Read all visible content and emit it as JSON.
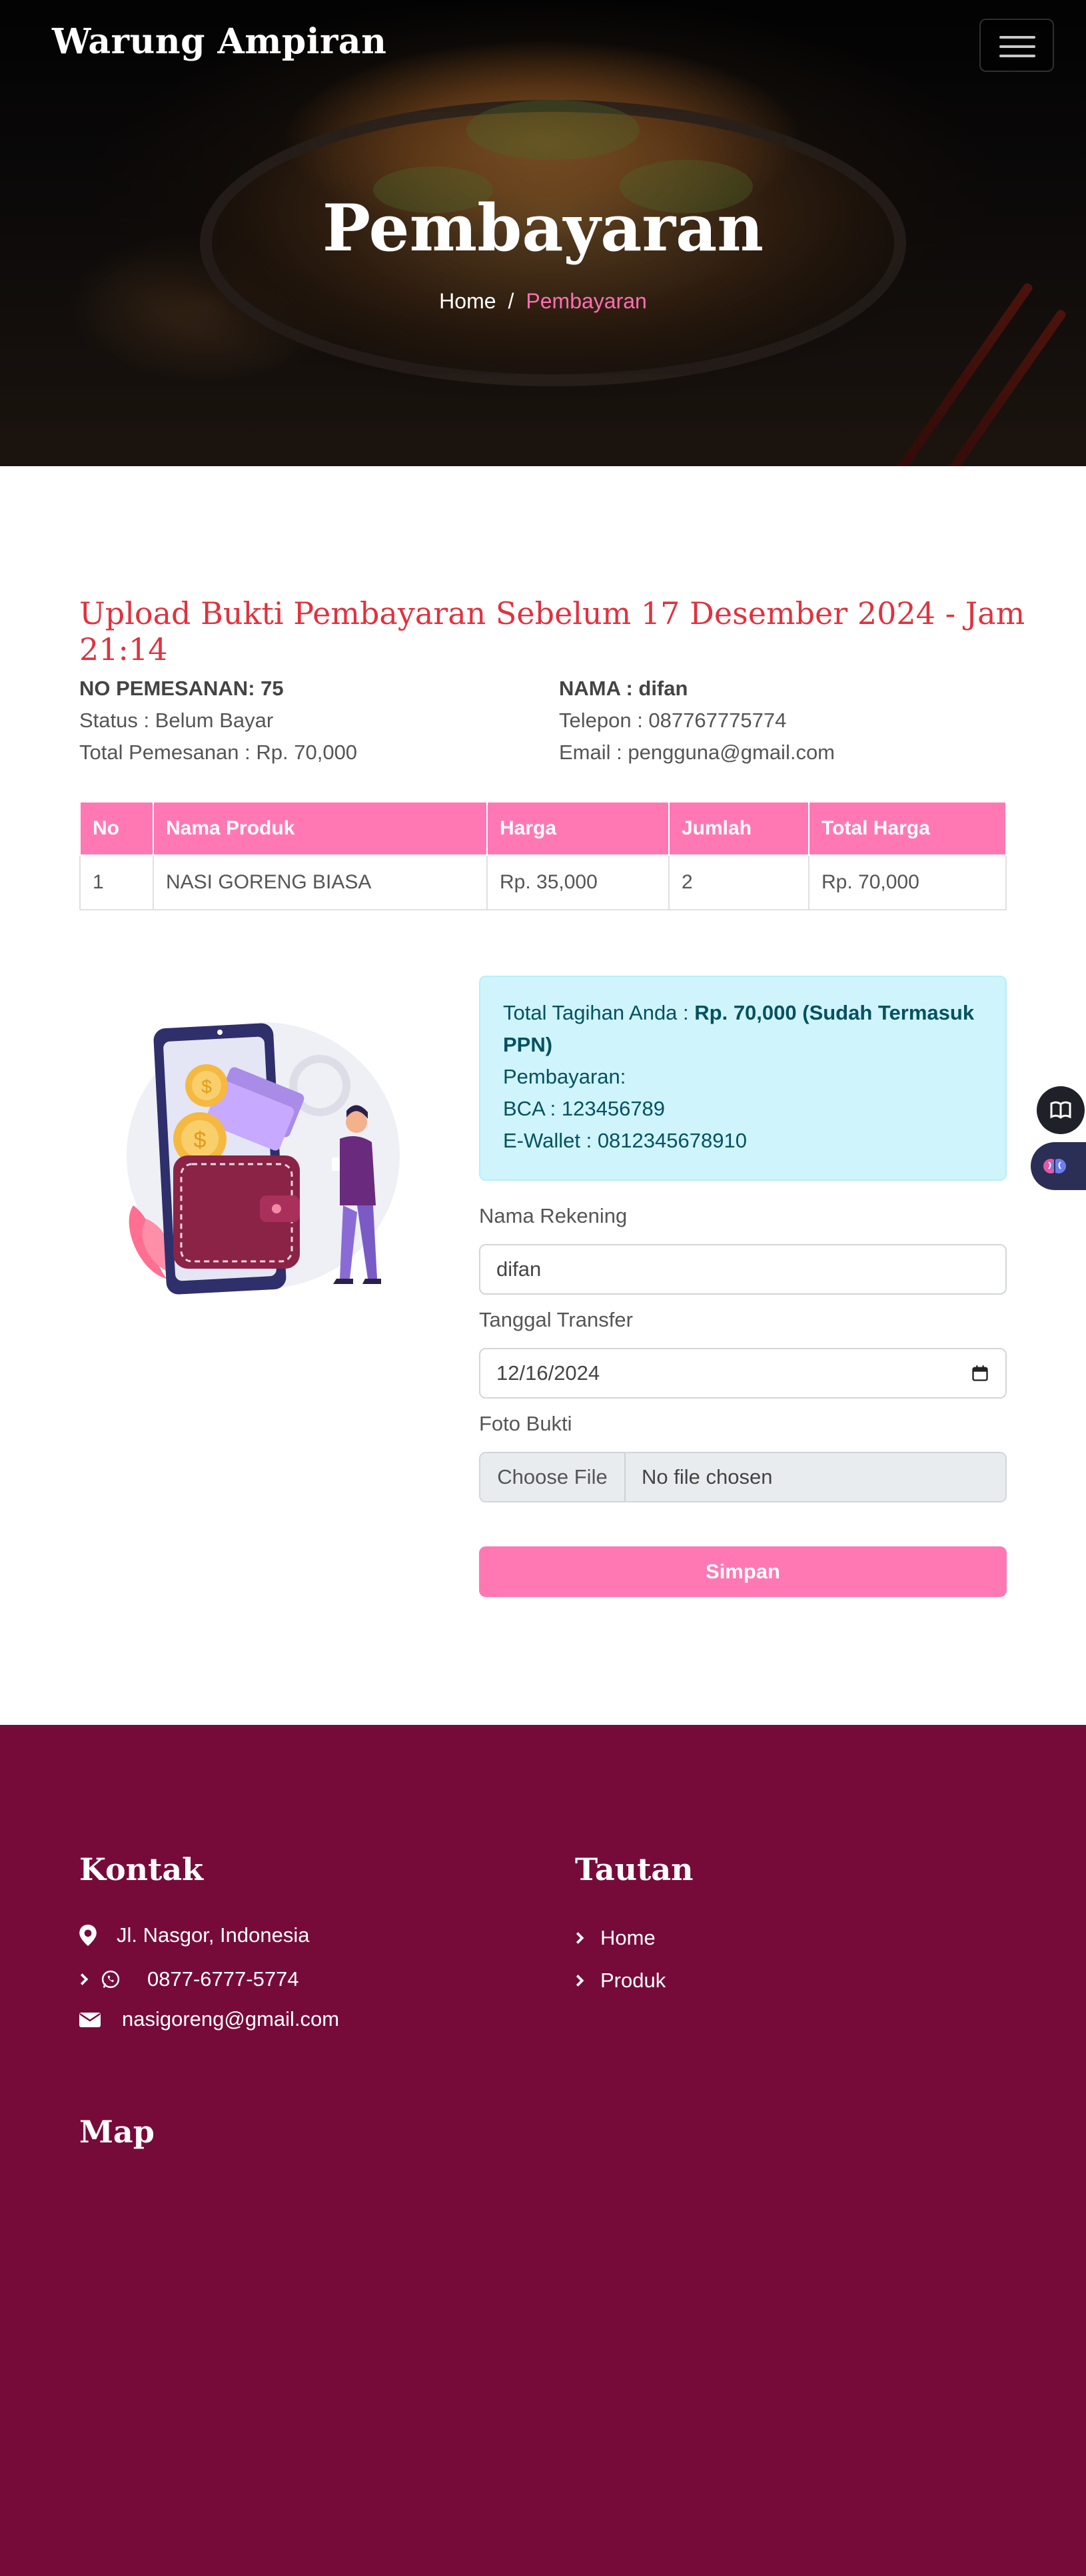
{
  "navbar": {
    "brand": "Warung Ampiran",
    "menu_icon": "hamburger-menu-icon"
  },
  "hero": {
    "title": "Pembayaran",
    "breadcrumb": {
      "home": "Home",
      "separator": "/",
      "current": "Pembayaran"
    }
  },
  "order": {
    "heading": "Upload Bukti Pembayaran Sebelum 17 Desember 2024 - Jam 21:14",
    "number": "NO PEMESANAN: 75",
    "status": "Status : Belum Bayar",
    "total": "Total Pemesanan : Rp. 70,000",
    "name": "NAMA : difan",
    "phone": "Telepon : 087767775774",
    "email": "Email : pengguna@gmail.com"
  },
  "table": {
    "headers": [
      "No",
      "Nama Produk",
      "Harga",
      "Jumlah",
      "Total Harga"
    ],
    "rows": [
      [
        "1",
        "NASI GORENG BIASA",
        "Rp. 35,000",
        "2",
        "Rp. 70,000"
      ]
    ]
  },
  "payment": {
    "bill_prefix": "Total Tagihan Anda : ",
    "bill_amount": "Rp. 70,000 (Sudah Termasuk PPN)",
    "methods_title": "Pembayaran:",
    "bca": "BCA : 123456789",
    "ewallet": "E-Wallet : 0812345678910",
    "account_label": "Nama Rekening",
    "account_value": "difan",
    "date_label": "Tanggal Transfer",
    "date_value": "12/16/2024",
    "proof_label": "Foto Bukti",
    "file_button": "Choose File",
    "file_status": "No file chosen",
    "submit": "Simpan"
  },
  "footer": {
    "contact_title": "Kontak",
    "address": "Jl. Nasgor, Indonesia",
    "phone": "0877-6777-5774",
    "email": "nasigoreng@gmail.com",
    "links_title": "Tautan",
    "links": [
      "Home",
      "Produk"
    ],
    "map_title": "Map"
  },
  "colors": {
    "accent_pink": "#ff78b4",
    "heading_red": "#e0323f",
    "footer_bg": "#760b3a",
    "alert_bg": "#cff4fc",
    "alert_text": "#055160"
  }
}
